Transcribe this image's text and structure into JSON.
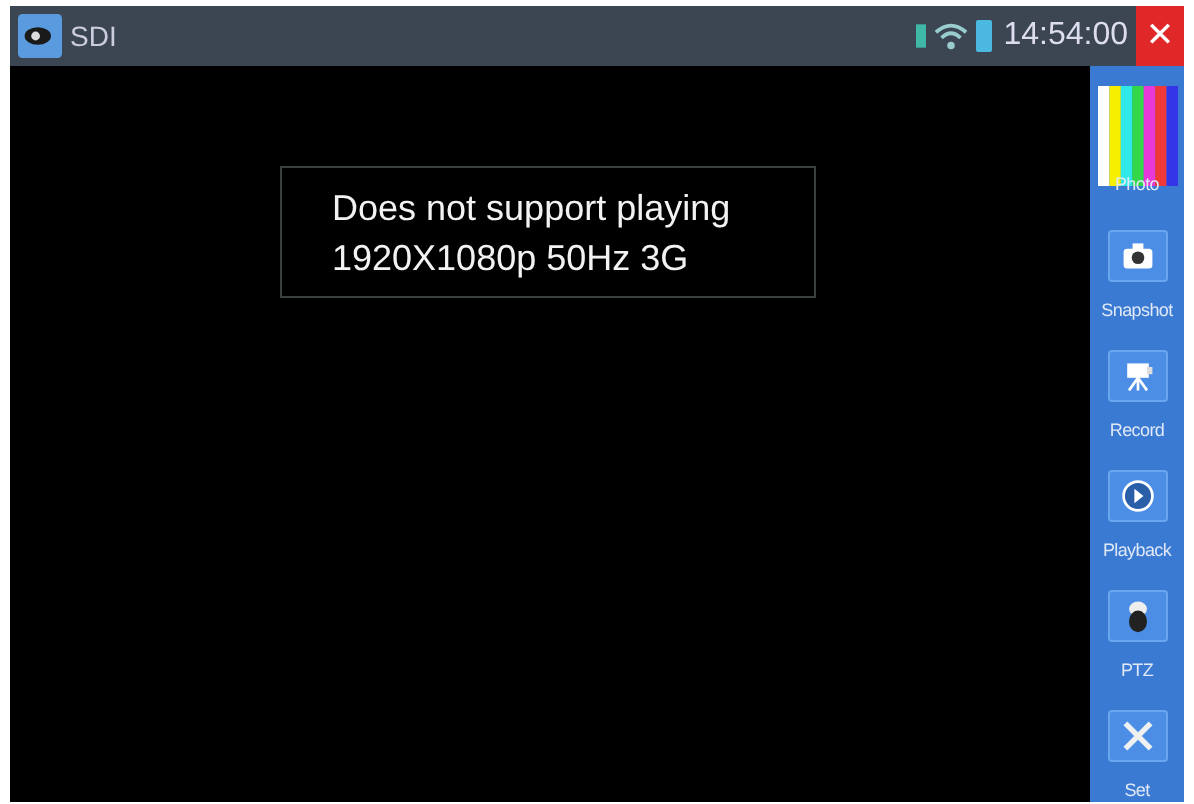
{
  "window": {
    "title": "SDI"
  },
  "status": {
    "time": "14:54:00",
    "close": "✕"
  },
  "message": [
    "Does not support playing",
    "1920X1080p 50Hz 3G"
  ],
  "sidebar": {
    "items": [
      {
        "label": "Photo",
        "kind": "bars"
      },
      {
        "label": "Snapshot",
        "kind": "button"
      },
      {
        "label": "Record",
        "kind": "button"
      },
      {
        "label": "Playback",
        "kind": "button"
      },
      {
        "label": "PTZ",
        "kind": "button"
      },
      {
        "label": "Set",
        "kind": "button"
      }
    ]
  }
}
